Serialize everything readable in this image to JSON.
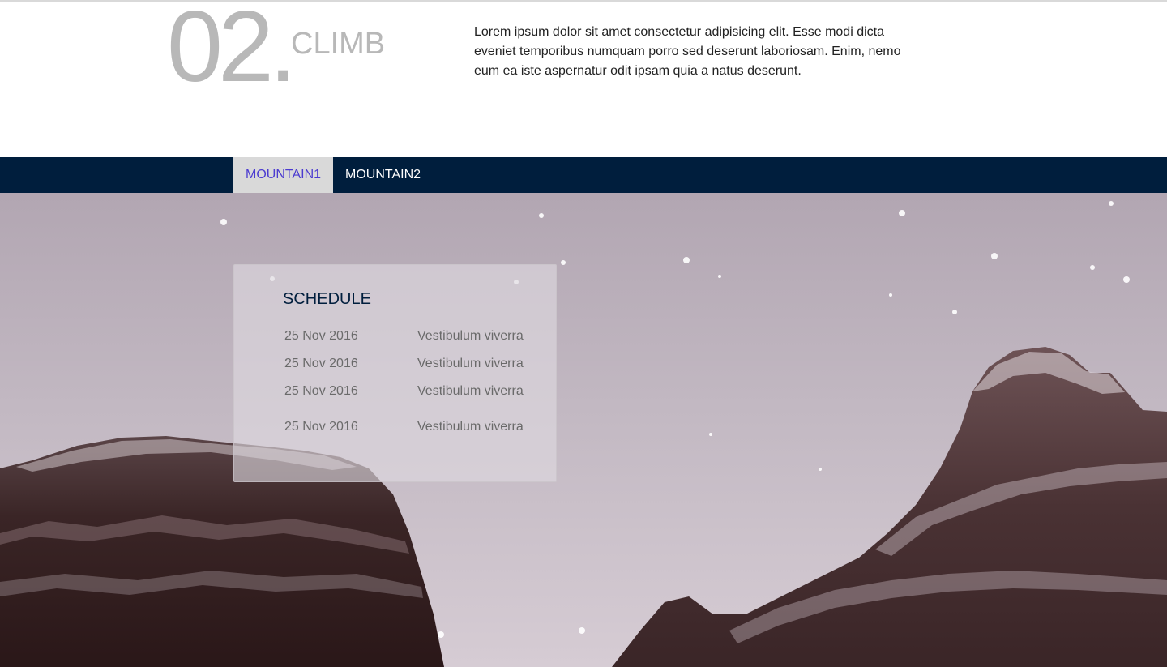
{
  "intro": {
    "number": "02.",
    "title": "CLIMB",
    "text": "Lorem ipsum dolor sit amet consectetur adipisicing elit. Esse modi dicta eveniet temporibus numquam porro sed deserunt laboriosam. Enim, nemo eum ea iste aspernatur odit ipsam quia a natus deserunt."
  },
  "tabs": [
    {
      "label": "MOUNTAIN1",
      "active": true
    },
    {
      "label": "MOUNTAIN2",
      "active": false
    }
  ],
  "schedule": {
    "title": "SCHEDULE",
    "rows": [
      {
        "date": "25 Nov 2016",
        "description": "Vestibulum viverra"
      },
      {
        "date": "25 Nov 2016",
        "description": "Vestibulum viverra"
      },
      {
        "date": "25 Nov 2016",
        "description": "Vestibulum viverra"
      },
      {
        "date": "25 Nov 2016",
        "description": "Vestibulum viverra"
      }
    ]
  },
  "colors": {
    "navy": "#001e3d",
    "active_tab_bg": "#d9d9d9",
    "active_tab_text": "#4b3bd0",
    "muted_gray": "#b8b8b8"
  }
}
